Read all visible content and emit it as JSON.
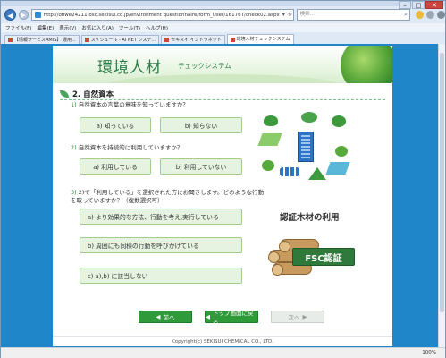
{
  "browser": {
    "address": "http://ofiwe24211.osc.sekisui.co.jp/environment questionnaire/form_User/16176T/check02.aspx",
    "search_placeholder": "検索...",
    "menu": [
      "ファイル(F)",
      "編集(E)",
      "表示(V)",
      "お気に入り(A)",
      "ツール(T)",
      "ヘルプ(H)"
    ],
    "favorites": [
      {
        "label": "【情報サービスAMIS】 運用..."
      },
      {
        "label": "スケジュール - AI NET システ..."
      },
      {
        "label": "セキスイ イントラネット"
      },
      {
        "label": "環境人材チェックシステム"
      }
    ],
    "zoom": "100%"
  },
  "header": {
    "title": "環境人材",
    "subtitle": "チェックシステム"
  },
  "section": {
    "title": "2. 自然資本"
  },
  "questions": [
    {
      "num": "1)",
      "text": "自然資本の言葉の意味を知っていますか？",
      "options": [
        "a) 知っている",
        "b) 知らない"
      ]
    },
    {
      "num": "2)",
      "text": "自然資本を持続的に利用していますか？",
      "options": [
        "a) 利用している",
        "b) 利用していない"
      ]
    },
    {
      "num": "3)",
      "text": "2)で「利用している」を選択された方にお聞きします。どのような行動を取っていますか？（複数選択可）",
      "options": [
        "a) より効果的な方法、行動を考え,実行している",
        "b) 周囲にも同様の行動を呼びかけている",
        "c) a),b) に該当しない"
      ]
    }
  ],
  "cert": {
    "title": "認証木材の利用",
    "badge": "FSC認証"
  },
  "nav": {
    "next": "前へ",
    "top": "トップ画面に戻る",
    "prev": "次へ"
  },
  "footer": {
    "copyright": "Copyright(c) SEKISUI CHEMICAL CO., LTD."
  }
}
